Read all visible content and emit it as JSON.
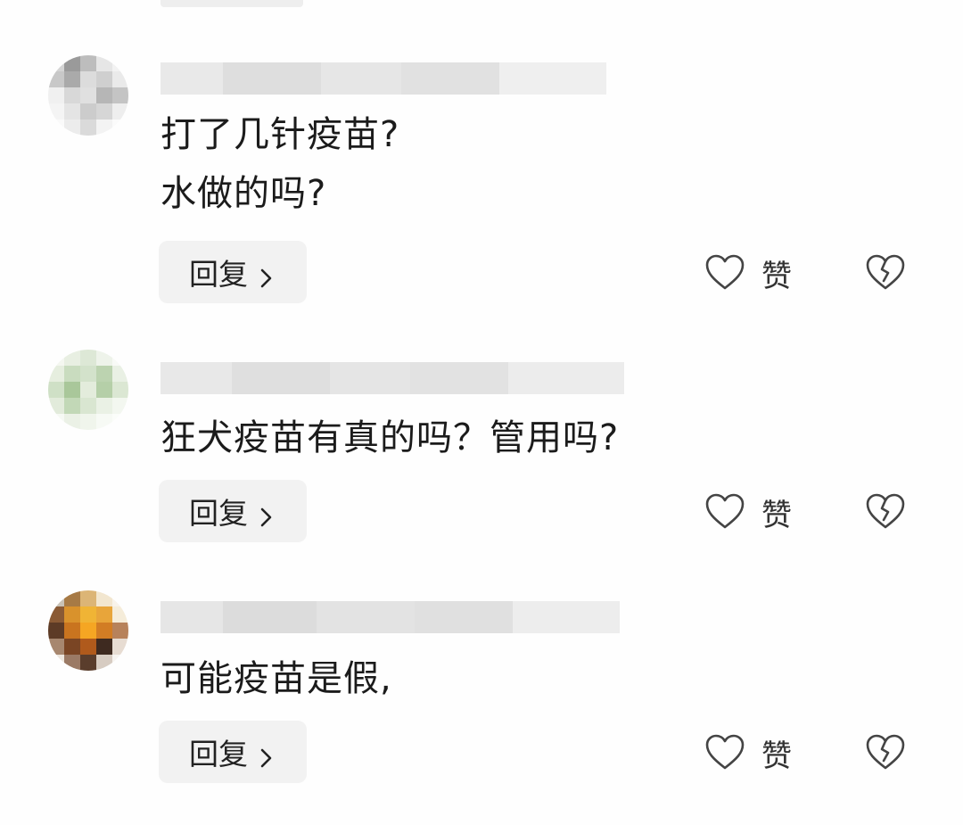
{
  "comments": [
    {
      "text": "打了几针疫苗?\n水做的吗?",
      "reply_label": "回复",
      "like_label": "赞"
    },
    {
      "text": "狂犬疫苗有真的吗？管用吗?",
      "reply_label": "回复",
      "like_label": "赞"
    },
    {
      "text": "可能疫苗是假,",
      "reply_label": "回复",
      "like_label": "赞"
    }
  ],
  "icons": {
    "like": "heart-outline-icon",
    "dislike": "broken-heart-icon",
    "reply_chevron": "chevron-right-icon"
  },
  "colors": {
    "reply_bg": "#f2f2f2",
    "text": "#1b1b1b",
    "icon": "#444444"
  }
}
